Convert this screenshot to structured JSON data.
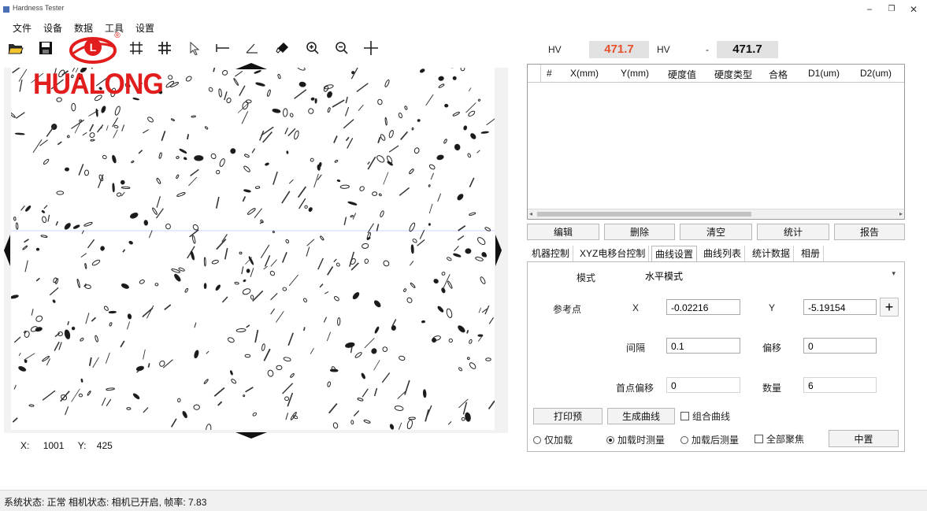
{
  "window": {
    "title": "Hardness Tester",
    "controls": [
      "−",
      "❐",
      "✕"
    ]
  },
  "menu": [
    "文件",
    "设备",
    "数据",
    "工具",
    "设置"
  ],
  "toolbar": {
    "icons": [
      "open-folder-icon",
      "save-icon",
      "grid-icon",
      "grid-alt-icon",
      "select-arrow-icon",
      "measure-line-icon",
      "angle-icon",
      "eraser-icon",
      "zoom-in-icon",
      "zoom-out-icon",
      "crosshair-icon"
    ]
  },
  "logo": {
    "brand": "HUALONG",
    "mark": "L",
    "registered": "®"
  },
  "coords": {
    "x_label": "X:",
    "x_value": "1001",
    "y_label": "Y:",
    "y_value": "425"
  },
  "hardness": {
    "unit_label": "HV",
    "value_1": "471.7",
    "unit_select": "HV",
    "separator": "-",
    "value_2": "471.7"
  },
  "table": {
    "columns": [
      "#",
      "X(mm)",
      "Y(mm)",
      "硬度值",
      "硬度类型",
      "合格",
      "D1(um)",
      "D2(um)"
    ],
    "rows": []
  },
  "actions": [
    "编辑",
    "删除",
    "清空",
    "统计",
    "报告"
  ],
  "tabs": [
    "机器控制",
    "XYZ电移台控制",
    "曲线设置",
    "曲线列表",
    "统计数据",
    "相册"
  ],
  "active_tab": "曲线设置",
  "curve": {
    "mode_label": "模式",
    "mode_value": "水平模式",
    "ref_label": "参考点",
    "x_label": "X",
    "x_value": "-0.02216",
    "y_label": "Y",
    "y_value": "-5.19154",
    "add_symbol": "+",
    "interval_label": "间隔",
    "interval_value": "0.1",
    "offset_label": "偏移",
    "offset_value": "0",
    "first_offset_label": "首点偏移",
    "first_offset_value": "0",
    "count_label": "数量",
    "count_value": "6",
    "print_button": "打印预",
    "generate_button": "生成曲线",
    "combine_label": "组合曲线",
    "radio_1": "仅加载",
    "radio_2": "加载时测量",
    "radio_3": "加载后测量",
    "all_focus_label": "全部聚焦",
    "middle_button": "中置"
  },
  "status": {
    "text": "系统状态: 正常    相机状态: 相机已开启, 帧率: 7.83"
  }
}
